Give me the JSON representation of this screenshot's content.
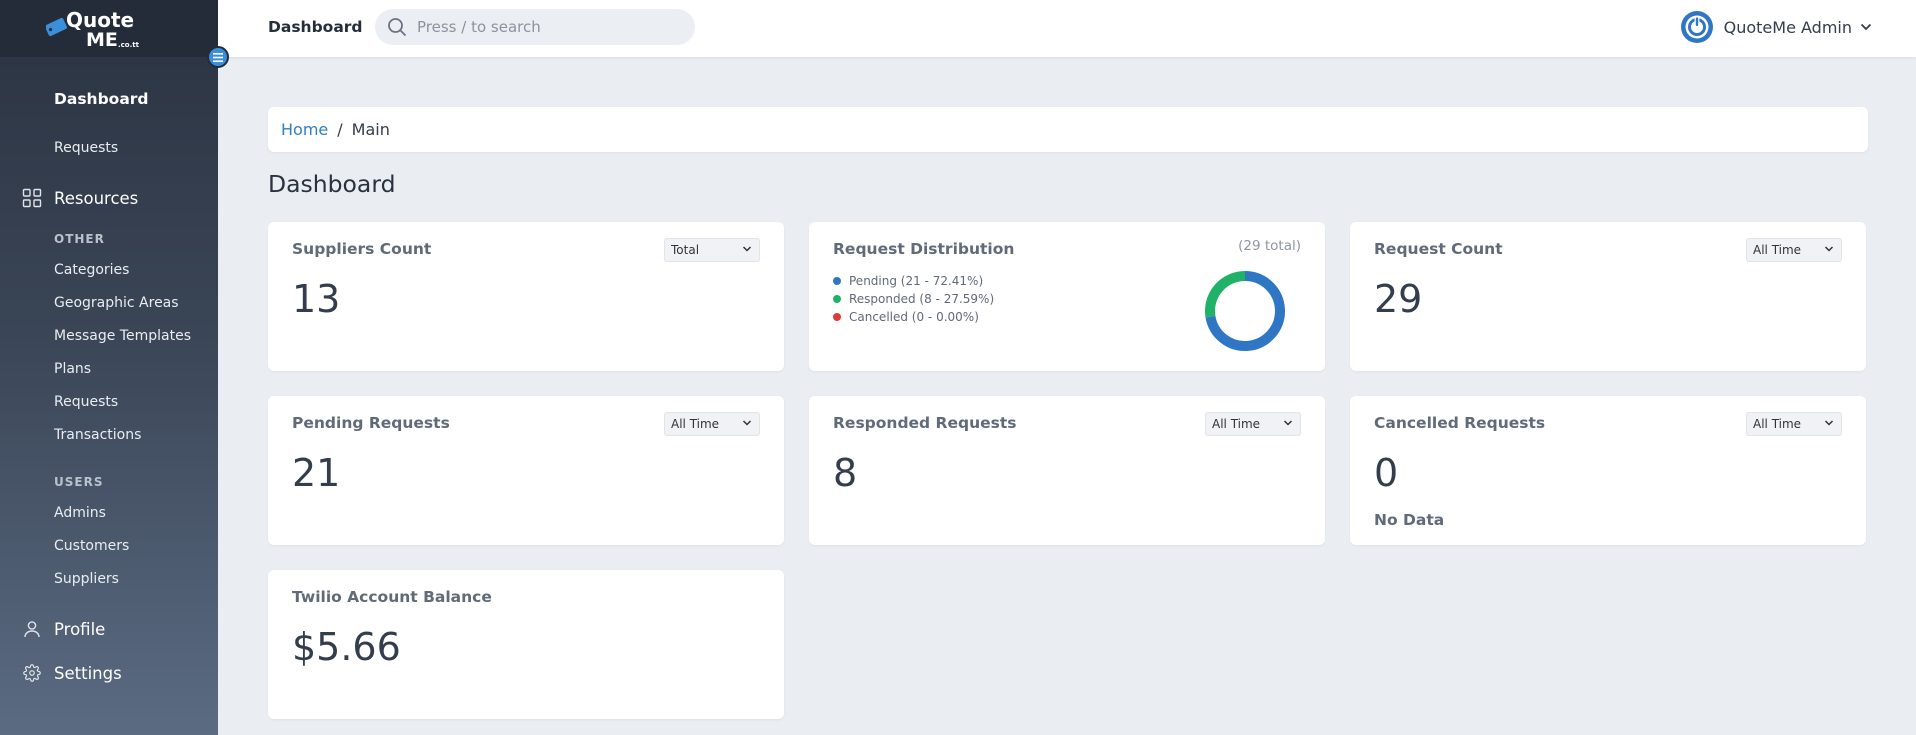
{
  "brand": {
    "logo_text_top": "Quote",
    "logo_text_bottom": "ME",
    "logo_domain": ".co.tt"
  },
  "header": {
    "title": "Dashboard",
    "search_placeholder": "Press / to search",
    "user_name": "QuoteMe Admin"
  },
  "sidebar": {
    "dashboard": "Dashboard",
    "requests_top": "Requests",
    "resources": "Resources",
    "section_other": "OTHER",
    "other_items": [
      "Categories",
      "Geographic Areas",
      "Message Templates",
      "Plans",
      "Requests",
      "Transactions"
    ],
    "section_users": "USERS",
    "user_items": [
      "Admins",
      "Customers",
      "Suppliers"
    ],
    "profile": "Profile",
    "settings": "Settings"
  },
  "breadcrumb": {
    "home": "Home",
    "separator": "/",
    "current": "Main"
  },
  "page_title": "Dashboard",
  "cards": {
    "suppliers": {
      "title": "Suppliers Count",
      "value": "13",
      "filter": "Total",
      "filter_options": [
        "Total"
      ]
    },
    "distribution": {
      "title": "Request Distribution",
      "total_label": "(29 total)",
      "legend": [
        {
          "label": "Pending (21 - 72.41%)",
          "color": "#2f77c4"
        },
        {
          "label": "Responded (8 - 27.59%)",
          "color": "#21b26a"
        },
        {
          "label": "Cancelled (0 - 0.00%)",
          "color": "#e03b3b"
        }
      ]
    },
    "request_count": {
      "title": "Request Count",
      "value": "29",
      "filter": "All Time"
    },
    "pending": {
      "title": "Pending Requests",
      "value": "21",
      "filter": "All Time"
    },
    "responded": {
      "title": "Responded Requests",
      "value": "8",
      "filter": "All Time"
    },
    "cancelled": {
      "title": "Cancelled Requests",
      "value": "0",
      "filter": "All Time",
      "empty_text": "No Data"
    },
    "twilio": {
      "title": "Twilio Account Balance",
      "value": "$5.66"
    }
  },
  "chart_data": {
    "type": "pie",
    "categories": [
      "Pending",
      "Responded",
      "Cancelled"
    ],
    "values": [
      21,
      8,
      0
    ],
    "colors": [
      "#2f77c4",
      "#21b26a",
      "#e03b3b"
    ],
    "title": "Request Distribution"
  }
}
